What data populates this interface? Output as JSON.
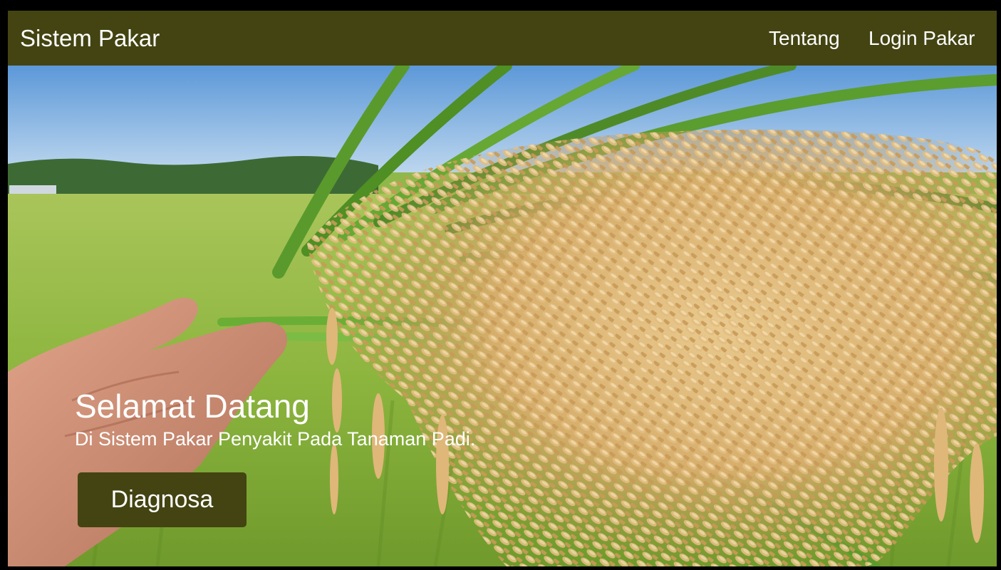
{
  "navbar": {
    "brand": "Sistem Pakar",
    "links": [
      {
        "label": "Tentang"
      },
      {
        "label": "Login Pakar"
      }
    ],
    "background_color": "#434412"
  },
  "hero": {
    "title": "Selamat Datang",
    "subtitle": "Di Sistem Pakar Penyakit Pada Tanaman Padi.",
    "button_label": "Diagnosa",
    "image_description_icon": "rice-field-photo"
  },
  "colors": {
    "accent": "#434412",
    "text": "#ffffff",
    "page_border": "#000000"
  }
}
